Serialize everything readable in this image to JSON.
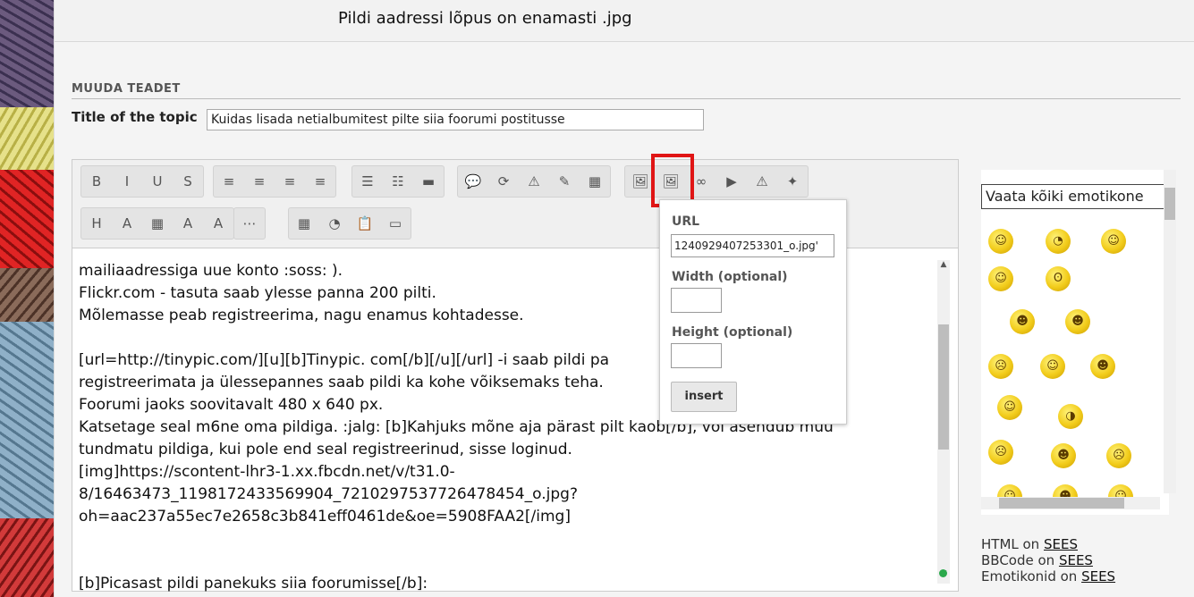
{
  "page": {
    "top_note": "Pildi aadressi lõpus on enamasti  .jpg",
    "section_title": "MUUDA TEADET",
    "topic_label": "Title of the topic",
    "topic_value": "Kuidas lisada netialbumitest pilte siia foorumi postitusse"
  },
  "toolbar": {
    "row1": [
      [
        "bold-button",
        "B"
      ],
      [
        "italic-button",
        "I"
      ],
      [
        "underline-button",
        "U"
      ],
      [
        "strike-button",
        "S"
      ],
      [
        "align-left-button",
        "≡"
      ],
      [
        "align-center-button",
        "≡"
      ],
      [
        "align-right-button",
        "≡"
      ],
      [
        "justify-button",
        "≡"
      ],
      [
        "bullet-list-button",
        "☰"
      ],
      [
        "number-list-button",
        "☷"
      ],
      [
        "hr-button",
        "▬"
      ],
      [
        "quote-button",
        "💬"
      ],
      [
        "code-button",
        "⟳"
      ],
      [
        "spoiler-button",
        "⚠"
      ],
      [
        "edit-button",
        "✎"
      ],
      [
        "table-button",
        "▦"
      ],
      [
        "image-upload-button",
        "🖼"
      ],
      [
        "insert-image-button",
        "🖼"
      ],
      [
        "link-button",
        "∞"
      ],
      [
        "youtube-button",
        "▶"
      ],
      [
        "warning-button",
        "⚠"
      ],
      [
        "flash-button",
        "✦"
      ]
    ],
    "row2": [
      [
        "heading-button",
        "H"
      ],
      [
        "font-size-button",
        "A"
      ],
      [
        "color-button",
        "▦"
      ],
      [
        "font-button",
        "A"
      ],
      [
        "remove-format-button",
        "A"
      ],
      [
        "more-button",
        "⋯"
      ],
      [
        "calendar-button",
        "▦"
      ],
      [
        "clock-button",
        "◔"
      ],
      [
        "paste-button",
        "📋"
      ],
      [
        "page-button",
        "▭"
      ]
    ]
  },
  "editor_text": "mailiaadressiga uue konto :soss: ).\nFlickr.com - tasuta saab ylesse panna 200 pilti.\nMõlemasse peab registreerima, nagu enamus kohtadesse.\n\n[url=http://tinypic.com/][u][b]Tinypic. com[/b][/u][/url] -i saab pildi pa\nregistreerimata ja ülessepannes saab pildi ka kohe võiksemaks teha.\nFoorumi jaoks soovitavalt 480 x 640 px.\nKatsetage seal m6ne oma pildiga. :jalg: [b]Kahjuks mõne aja pärast pilt kaob[/b], või asendub muu\ntundmatu pildiga, kui pole end seal registreerinud, sisse loginud.\n[img]https://scontent-lhr3-1.xx.fbcdn.net/v/t31.0-\n8/16463473_1198172433569904_7210297537726478454_o.jpg?\noh=aac237a55ec7e2658c3b841eff0461de&oe=5908FAA2[/img]\n\n\n[b]Picasast pildi panekuks siia foorumisse[/b]:",
  "popup": {
    "url_label": "URL",
    "url_value": "1240929407253301_o.jpg'",
    "width_label": "Width (optional)",
    "height_label": "Height (optional)",
    "insert_label": "insert"
  },
  "emoticons": {
    "search_value": "Vaata kõiki emotikone"
  },
  "footer": {
    "html_label": "HTML on",
    "html_link": "SEES",
    "bbcode_label": "BBCode on",
    "bbcode_link": "SEES",
    "emo_label": "Emotikonid on",
    "emo_link": "SEES"
  }
}
